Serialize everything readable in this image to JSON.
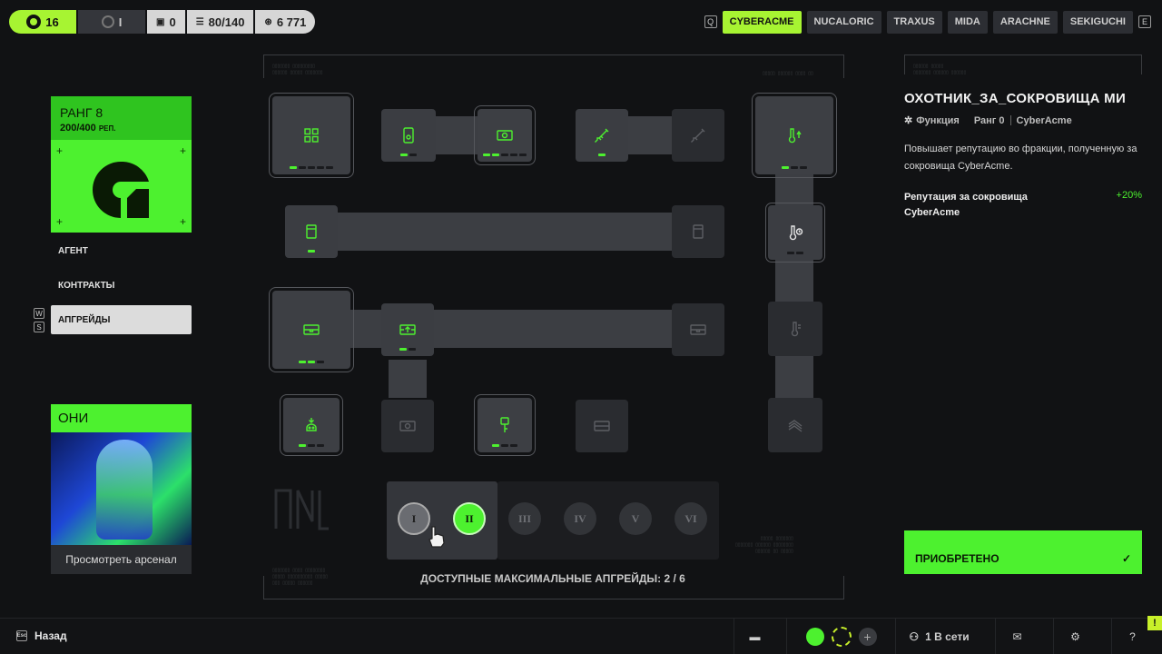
{
  "stats": {
    "level": "16",
    "rank": "I",
    "boxes": "0",
    "capacity": "80/140",
    "credits": "6 771"
  },
  "factions": {
    "left_key": "Q",
    "right_key": "E",
    "tabs": [
      "CYBERACME",
      "NUCALORIC",
      "TRAXUS",
      "MIDA",
      "ARACHNE",
      "SEKIGUCHI"
    ],
    "active": "CYBERACME"
  },
  "rank_card": {
    "title": "РАНГ 8",
    "rep_value": "200/400",
    "rep_unit": "РЕП."
  },
  "nav": {
    "items": [
      "АГЕНТ",
      "КОНТРАКТЫ",
      "АПГРЕЙДЫ"
    ],
    "active": "АПГРЕЙДЫ",
    "key_up": "W",
    "key_down": "S"
  },
  "oni_card": {
    "title": "ОНИ",
    "button": "Просмотреть арсенал"
  },
  "tiers": {
    "labels": [
      "I",
      "II",
      "III",
      "IV",
      "V",
      "VI"
    ],
    "selected": "II",
    "caption": "ДОСТУПНЫЕ МАКСИМАЛЬНЫЕ АПГРЕЙДЫ: 2 / 6"
  },
  "detail": {
    "title": "ОХОТНИК_ЗА_СОКРОВИЩА МИ",
    "type": "Функция",
    "rank": "Ранг 0",
    "faction": "CyberAcme",
    "description": "Повышает репутацию во фракции, полученную за сокровища CyberAcme.",
    "bonus_label": "Репутация за сокровища CyberAcme",
    "bonus_value": "+20%"
  },
  "acquired_button": "ПРИОБРЕТЕНО",
  "bottom": {
    "back": "Назад",
    "back_key": "Esc",
    "online": "1 В сети"
  },
  "colors": {
    "accent": "#4df12f",
    "accent_dark": "#2fc41f",
    "tab_active": "#a7f432",
    "background": "#111214",
    "node": "#3b3d42"
  },
  "icons": [
    "grid-icon",
    "phone-icon",
    "cash-icon",
    "syringe-icon",
    "thermometer-up-icon",
    "thermometer-clock-icon",
    "thermometer-icon",
    "canister-icon",
    "crate-icon",
    "crate-up-icon",
    "skull-icon",
    "key-icon",
    "stripes-icon",
    "check-icon",
    "chat-icon",
    "mail-icon",
    "gear-icon",
    "help-icon"
  ]
}
